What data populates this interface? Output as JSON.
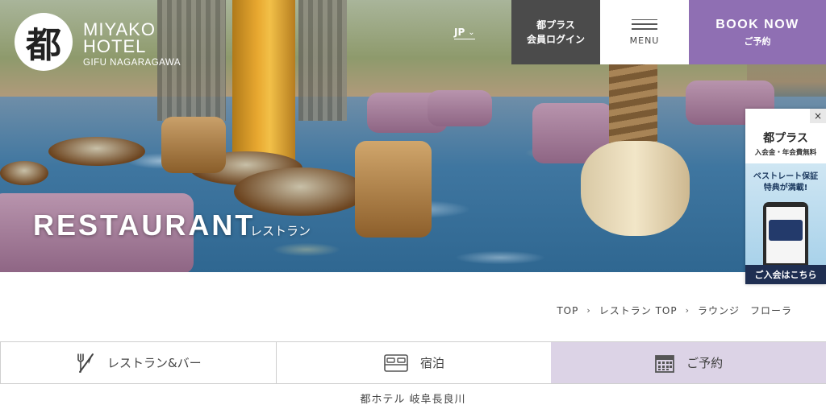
{
  "brand": {
    "logo_mark": "都",
    "name_line1": "MIYAKO",
    "name_line2": "HOTEL",
    "sub": "GIFU NAGARAGAWA"
  },
  "header": {
    "lang": "JP",
    "member_line1": "都プラス",
    "member_line2": "会員ログイン",
    "menu_label": "MENU",
    "book_main": "BOOK NOW",
    "book_sub": "ご予約"
  },
  "hero": {
    "title": "RESTAURANT",
    "title_jp": "レストラン"
  },
  "side_banner": {
    "close": "×",
    "title": "都プラス",
    "sub": "入会金・年会費無料",
    "promo_line1": "ベストレート保証",
    "promo_line2": "特典が満載!",
    "cta": "ご入会はこちら"
  },
  "breadcrumb": {
    "items": [
      "TOP",
      "レストラン TOP",
      "ラウンジ　フローラ"
    ],
    "separator": "›"
  },
  "tabs": [
    {
      "label": "レストラン&バー",
      "icon": "cutlery-icon"
    },
    {
      "label": "宿泊",
      "icon": "bed-icon"
    },
    {
      "label": "ご予約",
      "icon": "calendar-icon"
    }
  ],
  "footer": {
    "hotel_name": "都ホテル 岐阜長良川"
  },
  "colors": {
    "accent_purple": "#8f6fb3",
    "reserve_tab_bg": "#dcd3e6",
    "member_bg": "#4b4b4b",
    "banner_cta_bg": "#1f2f52"
  }
}
